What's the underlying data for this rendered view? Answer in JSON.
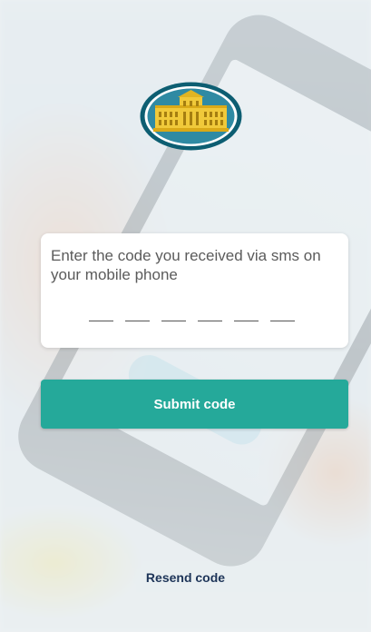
{
  "logo": {
    "icon": "bank-building-logo-icon",
    "colors": {
      "ring": "#0d5e72",
      "inner": "#2f8aa3",
      "building": "#f0c93a"
    }
  },
  "verification": {
    "prompt": "Enter the code you received via sms on your mobile phone",
    "code_length": 6,
    "code_value": ""
  },
  "actions": {
    "submit_label": "Submit code",
    "resend_label": "Resend code"
  },
  "theme": {
    "accent": "#25a99a",
    "link": "#1d3458"
  }
}
